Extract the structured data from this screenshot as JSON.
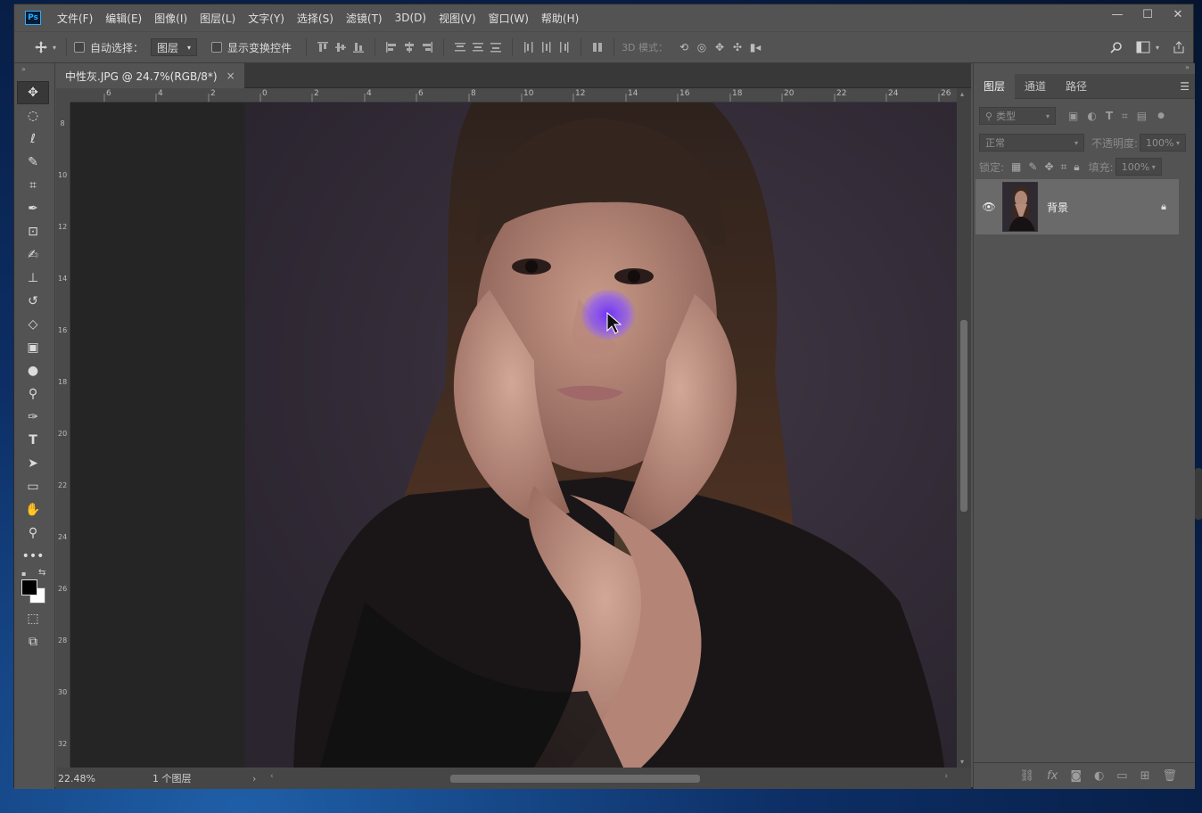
{
  "app": {
    "logo": "Ps"
  },
  "menu": [
    "文件(F)",
    "编辑(E)",
    "图像(I)",
    "图层(L)",
    "文字(Y)",
    "选择(S)",
    "滤镜(T)",
    "3D(D)",
    "视图(V)",
    "窗口(W)",
    "帮助(H)"
  ],
  "window_controls": {
    "minimize": "—",
    "maximize": "☐",
    "close": "✕"
  },
  "options": {
    "auto_select_label": "自动选择：",
    "auto_select_value": "图层",
    "show_transform_label": "显示变换控件",
    "mode3d_label": "3D 模式："
  },
  "document": {
    "tab_title": "中性灰.JPG @ 24.7%(RGB/8*)",
    "tab_close": "×",
    "zoom": "22.48%",
    "status_info": "1 个图层",
    "status_arrow": "›",
    "ruler_h": [
      "6",
      "4",
      "2",
      "0",
      "2",
      "4",
      "6",
      "8",
      "10",
      "12",
      "14",
      "16",
      "18",
      "20",
      "22",
      "24",
      "26"
    ],
    "ruler_v": [
      "8",
      "10",
      "12",
      "14",
      "16",
      "18",
      "20",
      "22",
      "24",
      "26",
      "28",
      "30",
      "32"
    ]
  },
  "panel": {
    "tabs": [
      "图层",
      "通道",
      "路径"
    ],
    "filter_placeholder": "类型",
    "blend_mode": "正常",
    "opacity_label": "不透明度:",
    "opacity_value": "100%",
    "lock_label": "锁定:",
    "fill_label": "填充:",
    "fill_value": "100%",
    "layers": [
      {
        "name": "背景",
        "visible": true,
        "locked": true
      }
    ]
  },
  "icons": [
    "move-icon",
    "marquee-icon",
    "lasso-icon",
    "quick-select-icon",
    "crop-icon",
    "eyedropper-icon",
    "frame-icon",
    "brush-icon",
    "stamp-icon",
    "history-brush-icon",
    "eraser-icon",
    "gradient-icon",
    "blur-icon",
    "dodge-icon",
    "pen-icon",
    "type-icon",
    "path-select-icon",
    "rectangle-icon",
    "hand-icon",
    "zoom-icon",
    "more-icon"
  ],
  "colors": {
    "foreground": "#000000",
    "background": "#ffffff",
    "highlight": "#7b3cff"
  }
}
